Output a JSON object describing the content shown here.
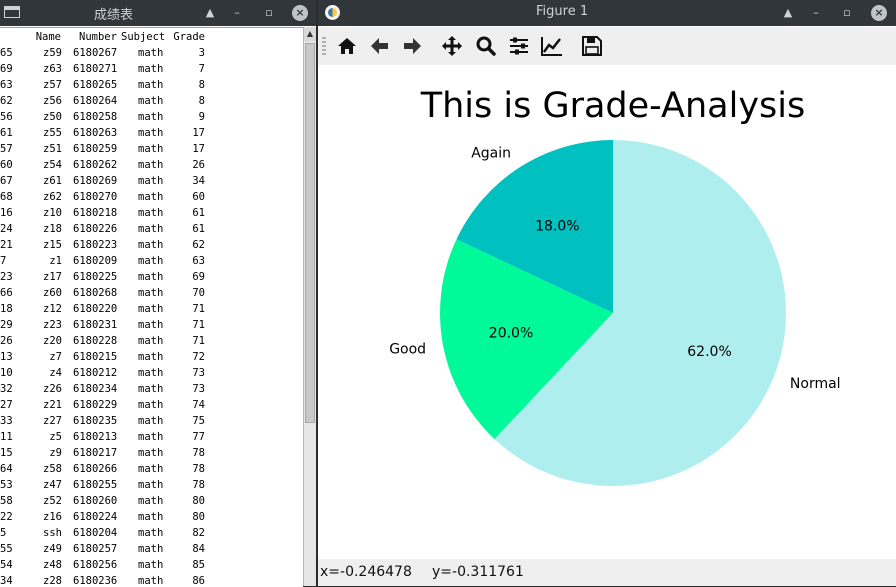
{
  "left_window": {
    "title": "成绩表",
    "columns": {
      "name": "Name",
      "number": "Number",
      "subject": "Subject",
      "grade": "Grade"
    },
    "rows": [
      {
        "idx": "65",
        "name": "z59",
        "number": "6180267",
        "subject": "math",
        "grade": "3"
      },
      {
        "idx": "69",
        "name": "z63",
        "number": "6180271",
        "subject": "math",
        "grade": "7"
      },
      {
        "idx": "63",
        "name": "z57",
        "number": "6180265",
        "subject": "math",
        "grade": "8"
      },
      {
        "idx": "62",
        "name": "z56",
        "number": "6180264",
        "subject": "math",
        "grade": "8"
      },
      {
        "idx": "56",
        "name": "z50",
        "number": "6180258",
        "subject": "math",
        "grade": "9"
      },
      {
        "idx": "61",
        "name": "z55",
        "number": "6180263",
        "subject": "math",
        "grade": "17"
      },
      {
        "idx": "57",
        "name": "z51",
        "number": "6180259",
        "subject": "math",
        "grade": "17"
      },
      {
        "idx": "60",
        "name": "z54",
        "number": "6180262",
        "subject": "math",
        "grade": "26"
      },
      {
        "idx": "67",
        "name": "z61",
        "number": "6180269",
        "subject": "math",
        "grade": "34"
      },
      {
        "idx": "68",
        "name": "z62",
        "number": "6180270",
        "subject": "math",
        "grade": "60"
      },
      {
        "idx": "16",
        "name": "z10",
        "number": "6180218",
        "subject": "math",
        "grade": "61"
      },
      {
        "idx": "24",
        "name": "z18",
        "number": "6180226",
        "subject": "math",
        "grade": "61"
      },
      {
        "idx": "21",
        "name": "z15",
        "number": "6180223",
        "subject": "math",
        "grade": "62"
      },
      {
        "idx": "7",
        "name": "z1",
        "number": "6180209",
        "subject": "math",
        "grade": "63"
      },
      {
        "idx": "23",
        "name": "z17",
        "number": "6180225",
        "subject": "math",
        "grade": "69"
      },
      {
        "idx": "66",
        "name": "z60",
        "number": "6180268",
        "subject": "math",
        "grade": "70"
      },
      {
        "idx": "18",
        "name": "z12",
        "number": "6180220",
        "subject": "math",
        "grade": "71"
      },
      {
        "idx": "29",
        "name": "z23",
        "number": "6180231",
        "subject": "math",
        "grade": "71"
      },
      {
        "idx": "26",
        "name": "z20",
        "number": "6180228",
        "subject": "math",
        "grade": "71"
      },
      {
        "idx": "13",
        "name": "z7",
        "number": "6180215",
        "subject": "math",
        "grade": "72"
      },
      {
        "idx": "10",
        "name": "z4",
        "number": "6180212",
        "subject": "math",
        "grade": "73"
      },
      {
        "idx": "32",
        "name": "z26",
        "number": "6180234",
        "subject": "math",
        "grade": "73"
      },
      {
        "idx": "27",
        "name": "z21",
        "number": "6180229",
        "subject": "math",
        "grade": "74"
      },
      {
        "idx": "33",
        "name": "z27",
        "number": "6180235",
        "subject": "math",
        "grade": "75"
      },
      {
        "idx": "11",
        "name": "z5",
        "number": "6180213",
        "subject": "math",
        "grade": "77"
      },
      {
        "idx": "15",
        "name": "z9",
        "number": "6180217",
        "subject": "math",
        "grade": "78"
      },
      {
        "idx": "64",
        "name": "z58",
        "number": "6180266",
        "subject": "math",
        "grade": "78"
      },
      {
        "idx": "53",
        "name": "z47",
        "number": "6180255",
        "subject": "math",
        "grade": "78"
      },
      {
        "idx": "58",
        "name": "z52",
        "number": "6180260",
        "subject": "math",
        "grade": "80"
      },
      {
        "idx": "22",
        "name": "z16",
        "number": "6180224",
        "subject": "math",
        "grade": "80"
      },
      {
        "idx": "5",
        "name": "ssh",
        "number": "6180204",
        "subject": "math",
        "grade": "82"
      },
      {
        "idx": "55",
        "name": "z49",
        "number": "6180257",
        "subject": "math",
        "grade": "84"
      },
      {
        "idx": "54",
        "name": "z48",
        "number": "6180256",
        "subject": "math",
        "grade": "85"
      },
      {
        "idx": "34",
        "name": "z28",
        "number": "6180236",
        "subject": "math",
        "grade": "86"
      }
    ]
  },
  "right_window": {
    "title": "Figure 1",
    "toolbar_icons": [
      "home-icon",
      "back-arrow-icon",
      "forward-arrow-icon",
      "pan-icon",
      "zoom-icon",
      "configure-subplots-icon",
      "edit-axes-icon",
      "save-icon"
    ],
    "status": {
      "x": "x=-0.246478",
      "y": "y=-0.311761"
    }
  },
  "colors": {
    "titlebar": "#31363b",
    "again": "#00c0c0",
    "good": "#00fa9a",
    "normal": "#afeeee"
  },
  "chart_data": {
    "type": "pie",
    "title": "This is Grade-Analysis",
    "slices": [
      {
        "label": "Again",
        "percent": 18.0,
        "pct_label": "18.0%",
        "color": "#00c0c0"
      },
      {
        "label": "Good",
        "percent": 20.0,
        "pct_label": "20.0%",
        "color": "#00fa9a"
      },
      {
        "label": "Normal",
        "percent": 62.0,
        "pct_label": "62.0%",
        "color": "#afeeee"
      }
    ],
    "start_angle_deg": 90,
    "direction": "counterclockwise"
  }
}
